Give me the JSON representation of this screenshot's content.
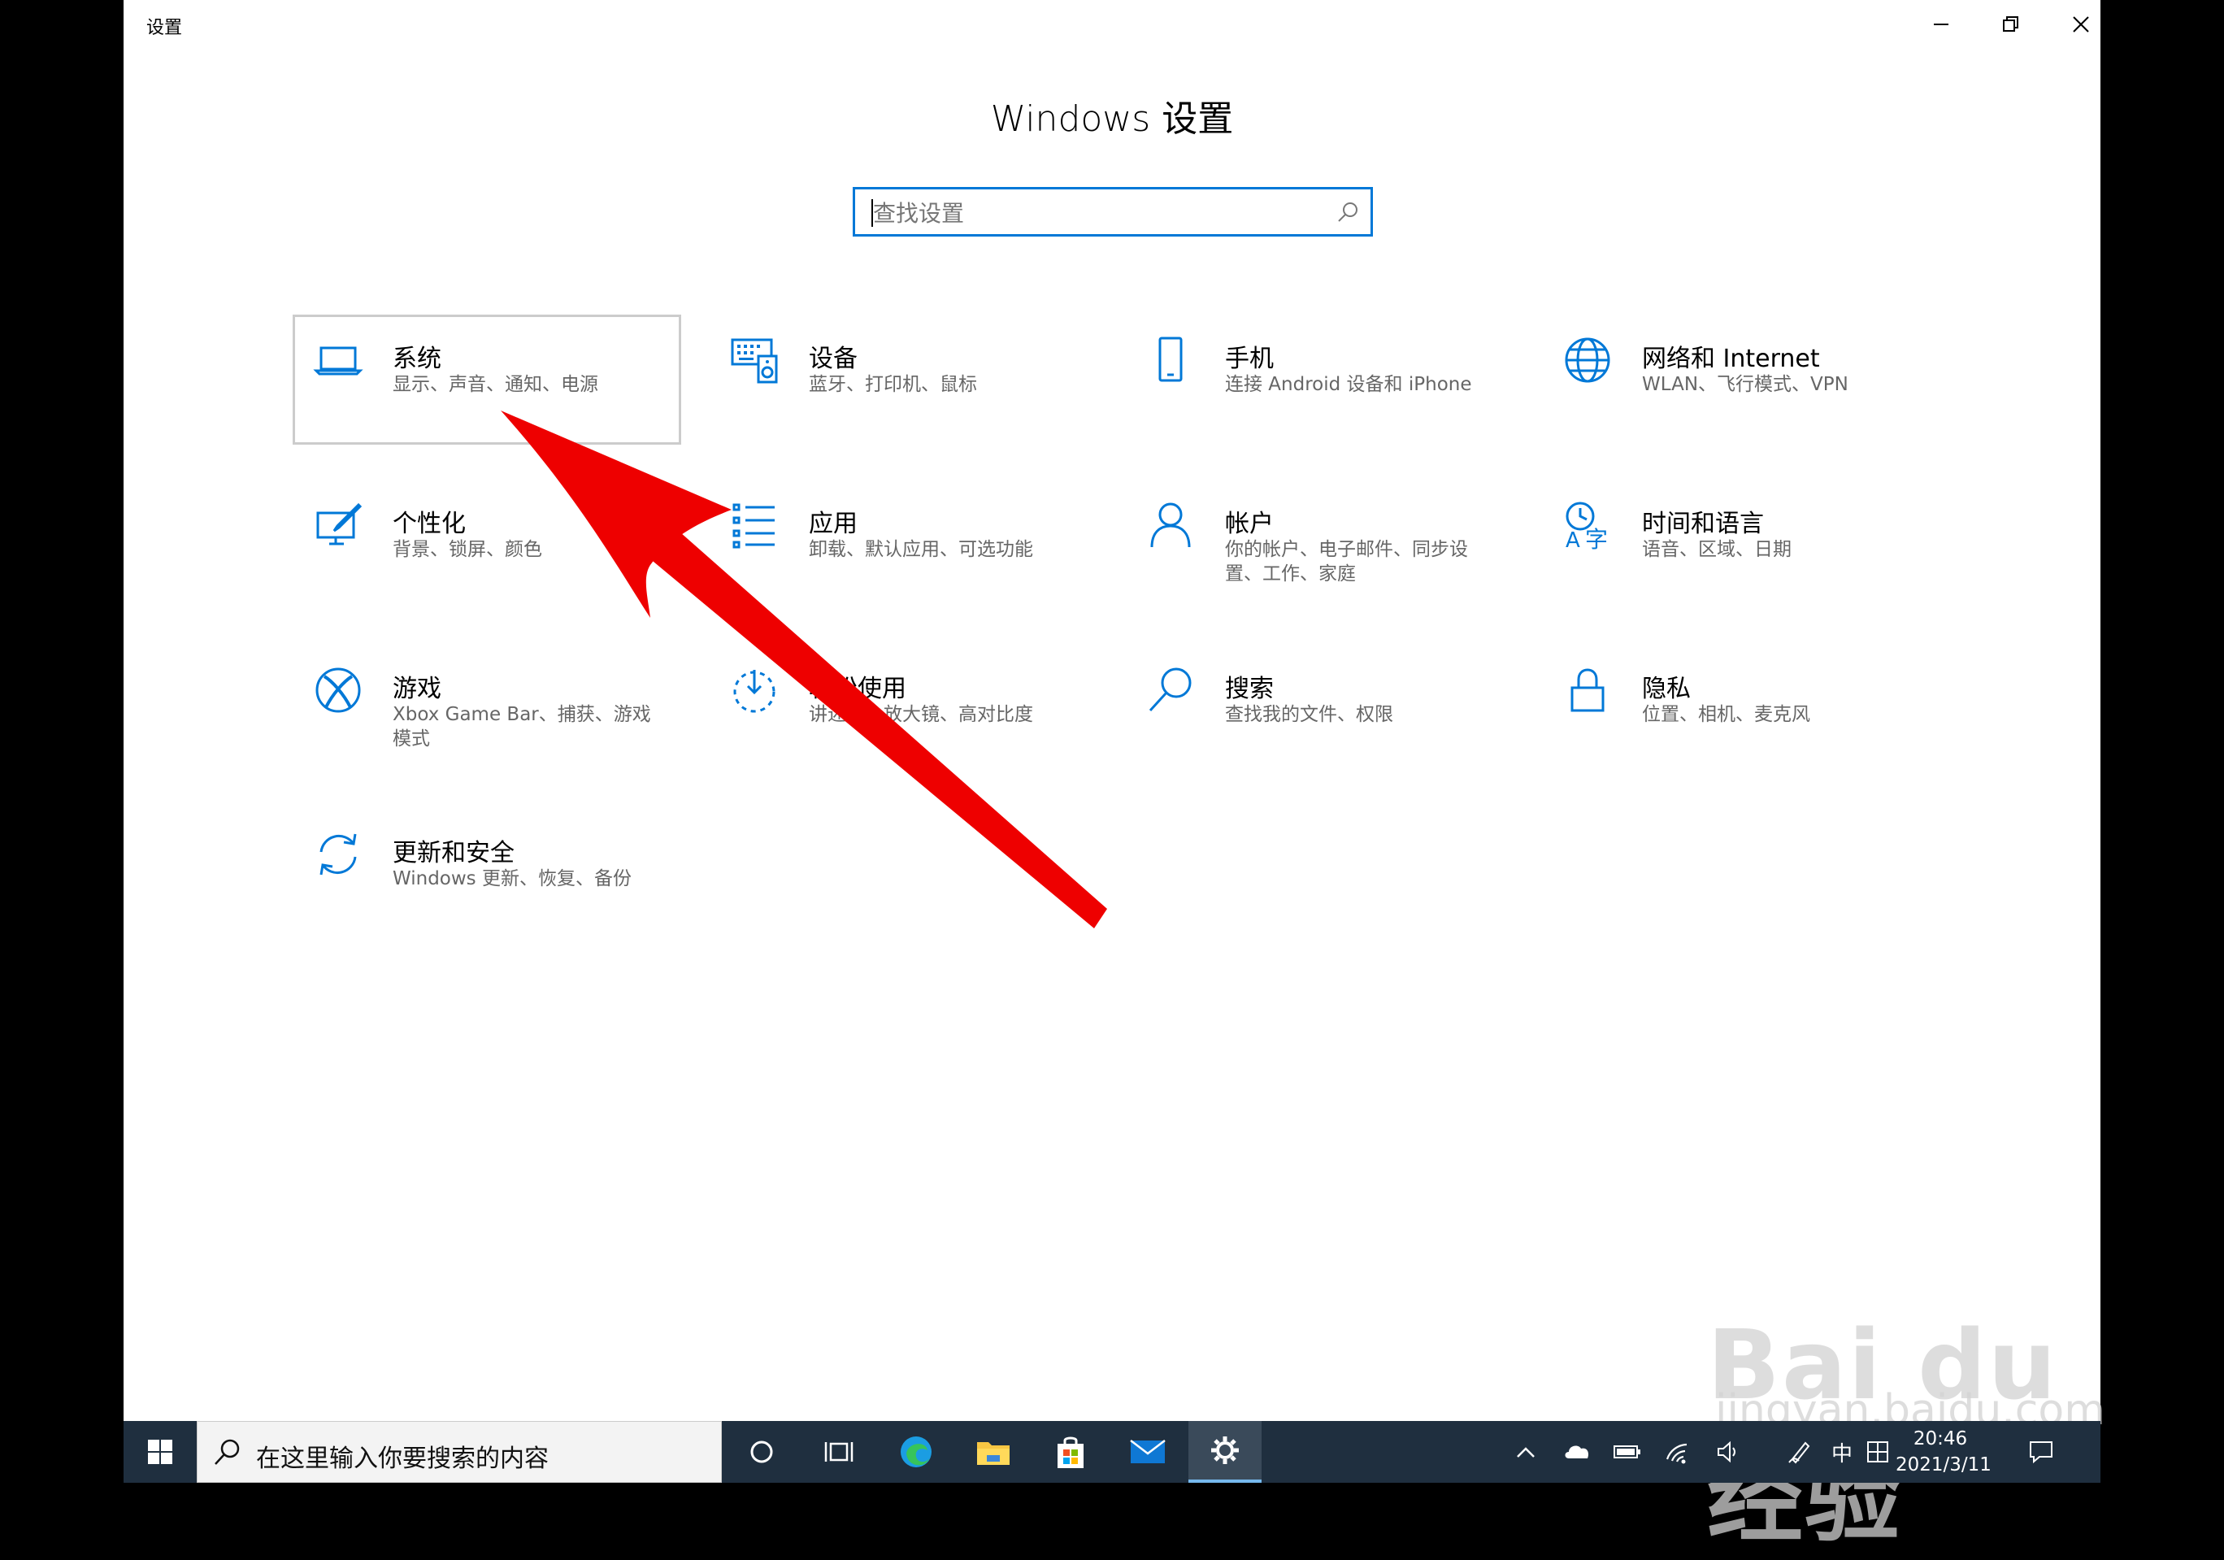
{
  "window": {
    "title": "设置",
    "heading": "Windows 设置",
    "search_placeholder": "查找设置"
  },
  "tiles": [
    {
      "title": "系统",
      "desc": "显示、声音、通知、电源",
      "icon": "laptop-icon"
    },
    {
      "title": "设备",
      "desc": "蓝牙、打印机、鼠标",
      "icon": "keyboard-speaker-icon"
    },
    {
      "title": "手机",
      "desc": "连接 Android 设备和 iPhone",
      "icon": "phone-icon"
    },
    {
      "title": "网络和 Internet",
      "desc": "WLAN、飞行模式、VPN",
      "icon": "globe-icon"
    },
    {
      "title": "个性化",
      "desc": "背景、锁屏、颜色",
      "icon": "brush-icon"
    },
    {
      "title": "应用",
      "desc": "卸载、默认应用、可选功能",
      "icon": "list-icon"
    },
    {
      "title": "帐户",
      "desc": "你的帐户、电子邮件、同步设置、工作、家庭",
      "icon": "person-icon"
    },
    {
      "title": "时间和语言",
      "desc": "语音、区域、日期",
      "icon": "time-language-icon"
    },
    {
      "title": "游戏",
      "desc": "Xbox Game Bar、捕获、游戏模式",
      "icon": "xbox-icon"
    },
    {
      "title": "轻松使用",
      "desc": "讲述人、放大镜、高对比度",
      "icon": "ease-of-access-icon"
    },
    {
      "title": "搜索",
      "desc": "查找我的文件、权限",
      "icon": "magnifier-icon"
    },
    {
      "title": "隐私",
      "desc": "位置、相机、麦克风",
      "icon": "lock-icon"
    },
    {
      "title": "更新和安全",
      "desc": "Windows 更新、恢复、备份",
      "icon": "refresh-icon"
    }
  ],
  "taskbar": {
    "search_text": "在这里输入你要搜索的内容",
    "ime": "中",
    "time": "20:46",
    "date": "2021/3/11"
  },
  "watermark": {
    "brand": "Bai du 经验",
    "url": "jingyan.baidu.com"
  },
  "colors": {
    "accent": "#0078d7",
    "arrow": "#ee0000",
    "taskbar": "#1f2f3f"
  }
}
